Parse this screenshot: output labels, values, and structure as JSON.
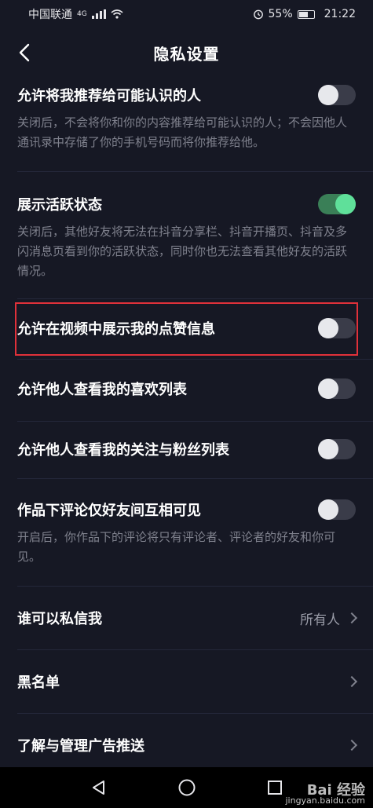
{
  "status_bar": {
    "carrier": "中国联通",
    "network": "4G",
    "battery": "55%",
    "time": "21:22"
  },
  "header": {
    "title": "隐私设置"
  },
  "settings": [
    {
      "title": "允许将我推荐给可能认识的人",
      "description": "关闭后，不会将你和你的内容推荐给可能认识的人；不会因他人通讯录中存储了你的手机号码而将你推荐给他。",
      "enabled": false
    },
    {
      "title": "展示活跃状态",
      "description": "关闭后，其他好友将无法在抖音分享栏、抖音开播页、抖音及多闪消息页看到你的活跃状态，同时你也无法查看其他好友的活跃情况。",
      "enabled": true
    },
    {
      "title": "允许在视频中展示我的点赞信息",
      "enabled": false
    },
    {
      "title": "允许他人查看我的喜欢列表",
      "enabled": false
    },
    {
      "title": "允许他人查看我的关注与粉丝列表",
      "enabled": false
    },
    {
      "title": "作品下评论仅好友间互相可见",
      "description": "开启后，你作品下的评论将只有评论者、评论者的好友和你可见。",
      "enabled": false
    }
  ],
  "nav_items": [
    {
      "title": "谁可以私信我",
      "value": "所有人"
    },
    {
      "title": "黑名单"
    },
    {
      "title": "了解与管理广告推送"
    }
  ],
  "watermark": {
    "brand": "Bai 经验",
    "url": "jingyan.baidu.com"
  },
  "colors": {
    "background": "#161824",
    "toggle_on": "#5fe09a",
    "highlight": "#e0313a"
  }
}
